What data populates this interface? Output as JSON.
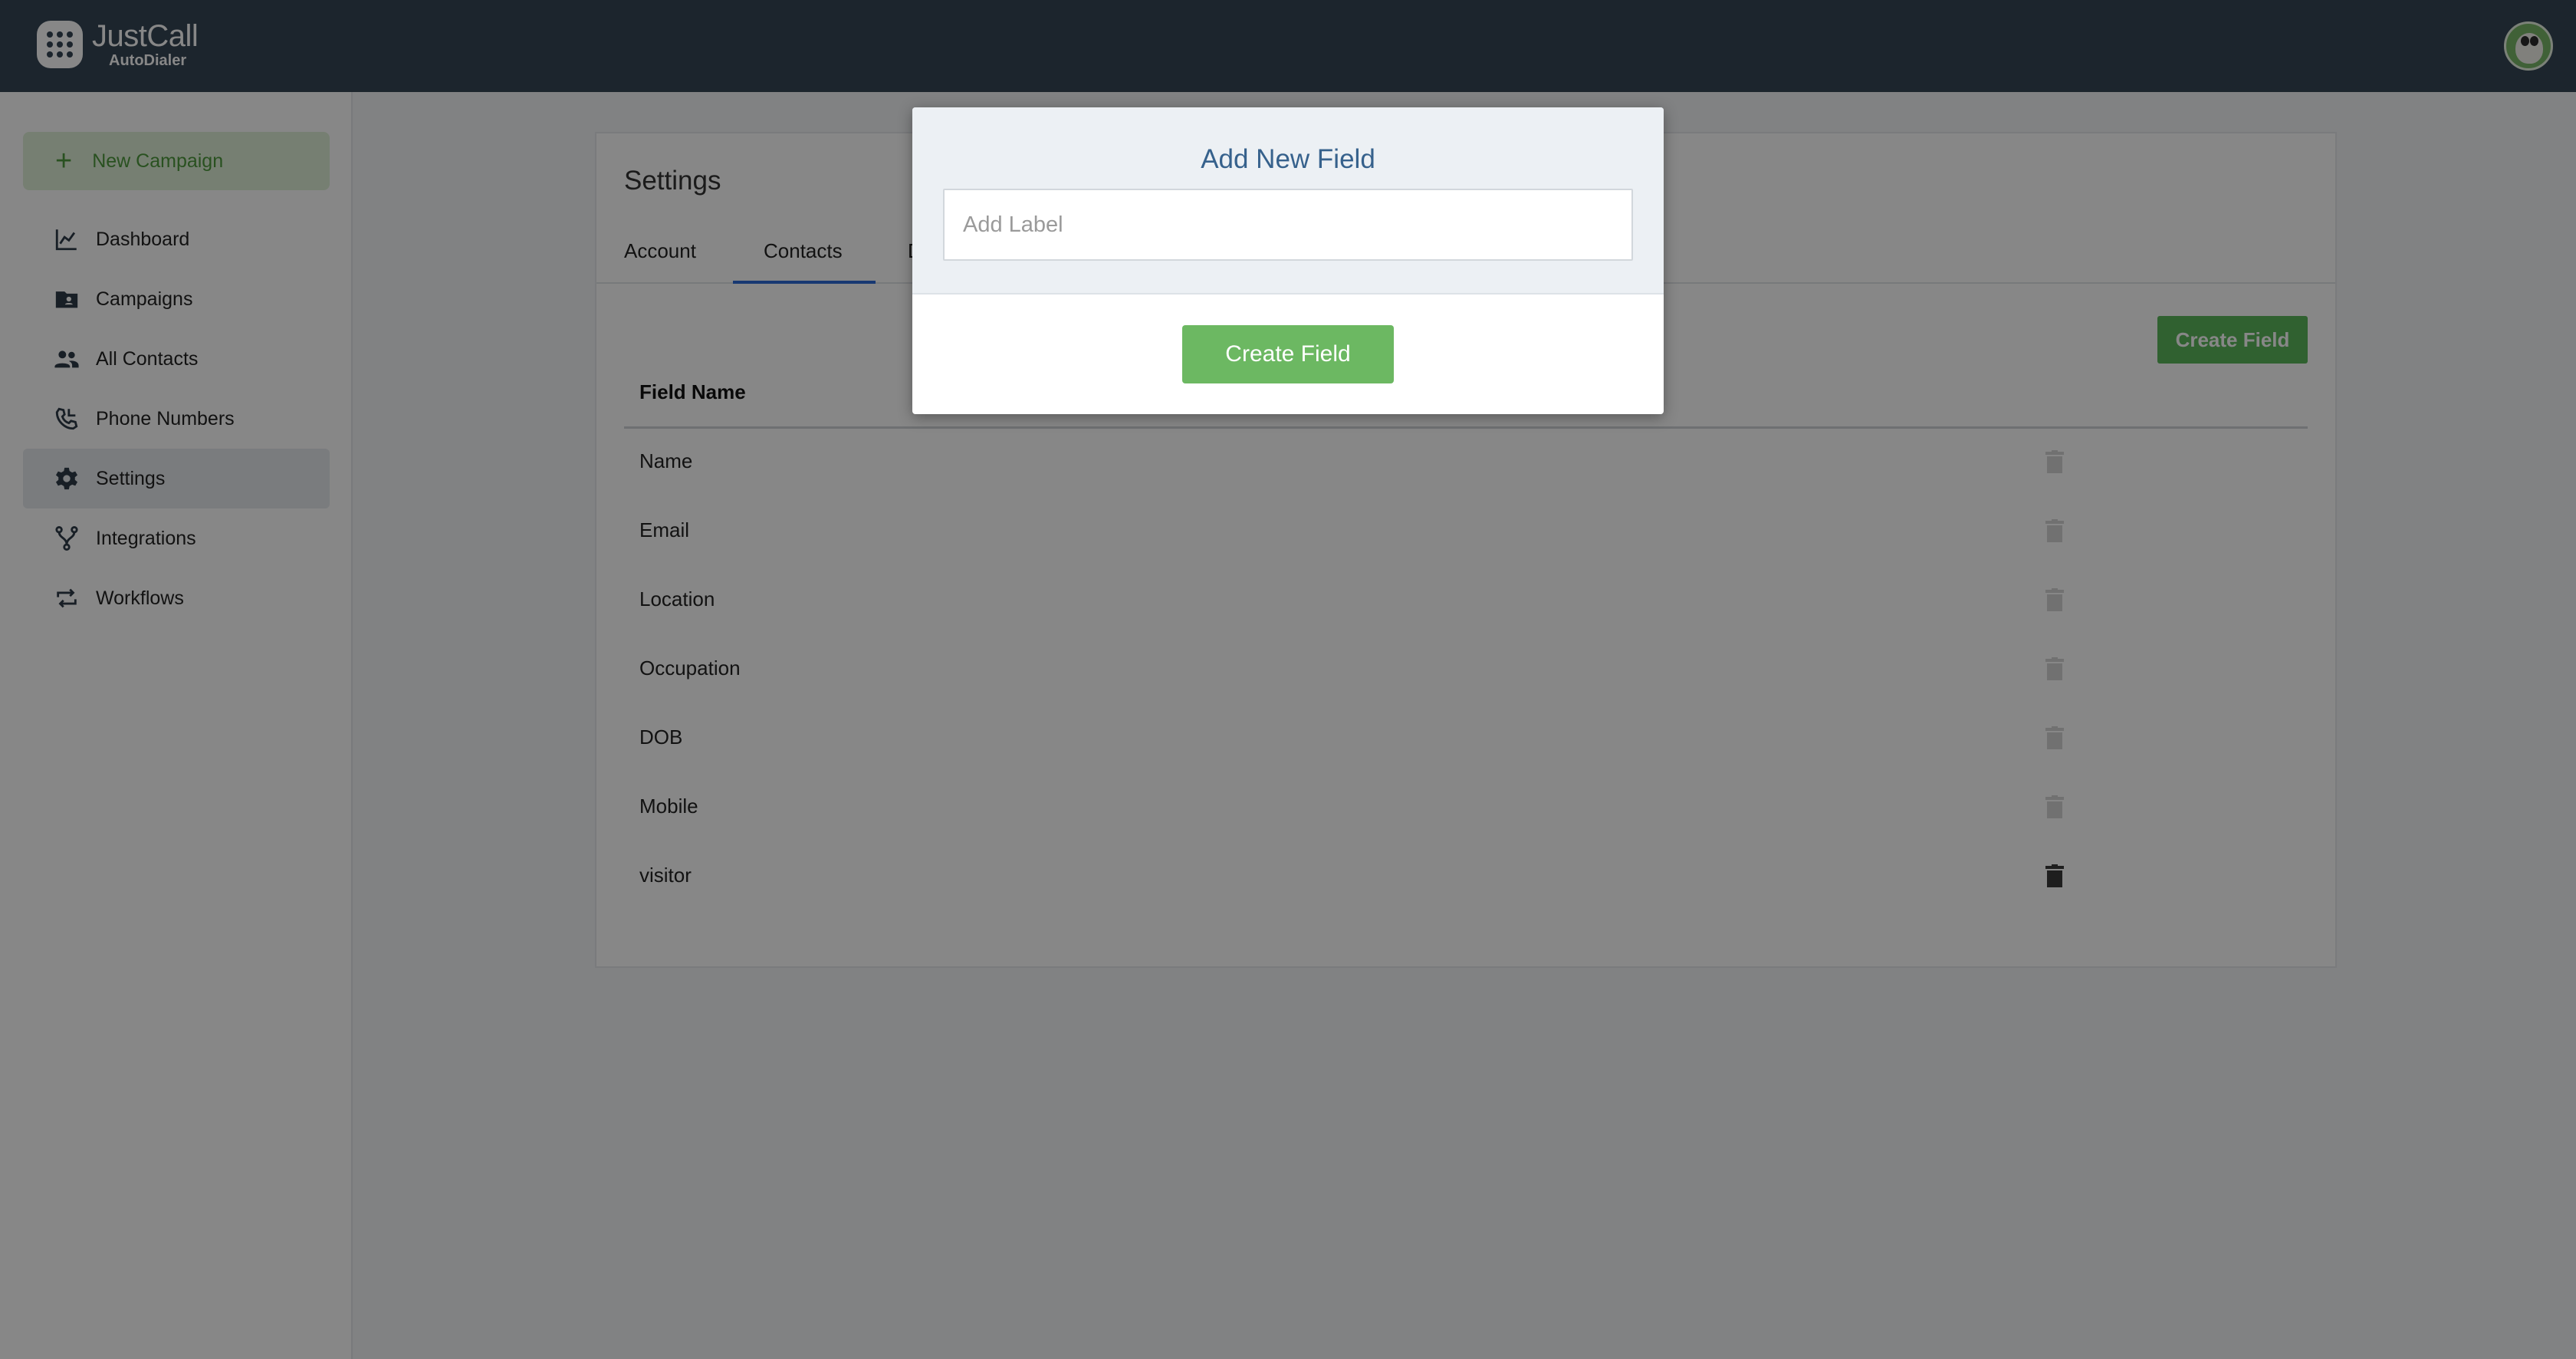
{
  "header": {
    "logo_name": "JustCall",
    "logo_sub": "AutoDialer"
  },
  "sidebar": {
    "new_campaign": "New Campaign",
    "items": [
      {
        "label": "Dashboard",
        "icon": "chart-line-icon"
      },
      {
        "label": "Campaigns",
        "icon": "folder-contact-icon"
      },
      {
        "label": "All Contacts",
        "icon": "people-icon"
      },
      {
        "label": "Phone Numbers",
        "icon": "phone-icon"
      },
      {
        "label": "Settings",
        "icon": "gear-icon",
        "active": true
      },
      {
        "label": "Integrations",
        "icon": "fork-icon"
      },
      {
        "label": "Workflows",
        "icon": "loop-arrows-icon"
      }
    ]
  },
  "settings": {
    "title": "Settings",
    "tabs": [
      "Account",
      "Contacts",
      "D"
    ],
    "active_tab": "Contacts",
    "create_button": "Create Field",
    "column_header": "Field Name",
    "fields": [
      "Name",
      "Email",
      "Location",
      "Occupation",
      "DOB",
      "Mobile",
      "visitor"
    ]
  },
  "modal": {
    "title": "Add New Field",
    "input_placeholder": "Add Label",
    "input_value": "",
    "submit_label": "Create Field"
  },
  "colors": {
    "topbar": "#364656",
    "accent_green": "#5cb85c",
    "tab_underline": "#2d6ad8",
    "modal_title": "#36618c"
  }
}
